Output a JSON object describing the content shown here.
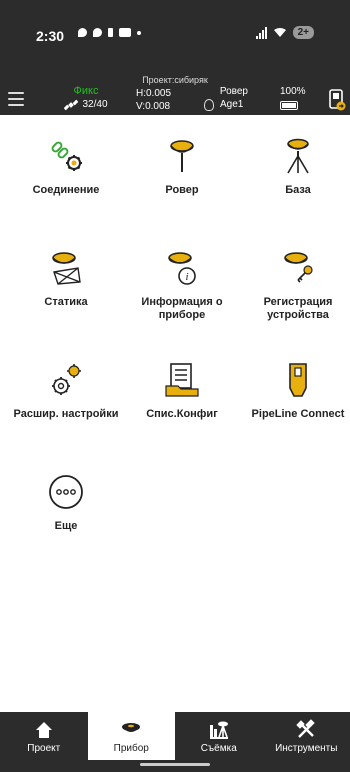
{
  "status_bar": {
    "time": "2:30",
    "battery_label": "2+"
  },
  "project": {
    "label": "Проект:сибиряк"
  },
  "info_bar": {
    "fix_status": "Фикс",
    "satellites": "32/40",
    "h_precision": "H:0.005",
    "v_precision": "V:0.008",
    "mode": "Ровер",
    "age": "Age1",
    "battery_percent": "100%",
    "colors": {
      "fix": "#21c121",
      "bar_bg": "#2c2c2c"
    }
  },
  "grid_items": [
    {
      "label": "Соединение",
      "icon": "connection-gear-icon"
    },
    {
      "label": "Ровер",
      "icon": "rover-receiver-icon"
    },
    {
      "label": "База",
      "icon": "base-tripod-icon"
    },
    {
      "label": "Статика",
      "icon": "static-survey-icon"
    },
    {
      "label": "Информация о приборе",
      "icon": "device-info-icon"
    },
    {
      "label": "Регистрация устройства",
      "icon": "device-register-key-icon"
    },
    {
      "label": "Расшир. настройки",
      "icon": "advanced-settings-gears-icon"
    },
    {
      "label": "Спис.Конфиг",
      "icon": "config-list-icon"
    },
    {
      "label": "PipeLine Connect",
      "icon": "pipeline-connect-icon"
    },
    {
      "label": "Еще",
      "icon": "more-dots-icon"
    }
  ],
  "tabs": [
    {
      "label": "Проект",
      "icon": "home-icon",
      "active": false
    },
    {
      "label": "Прибор",
      "icon": "receiver-icon",
      "active": true
    },
    {
      "label": "Съёмка",
      "icon": "survey-icon",
      "active": false
    },
    {
      "label": "Инструменты",
      "icon": "tools-icon",
      "active": false
    }
  ],
  "accent_color": "#e8b00f"
}
